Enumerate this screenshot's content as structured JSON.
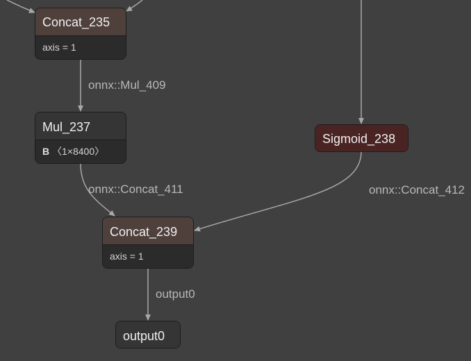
{
  "colors": {
    "background": "#404040",
    "edge": "#a8a8a8",
    "concat_header": "#4f403c",
    "mul_header": "#353535",
    "sigmoid": "#4a2422",
    "attr_bg": "#2b2b2b"
  },
  "nodes": {
    "concat_235": {
      "title": "Concat_235",
      "attr": "axis = 1"
    },
    "mul_237": {
      "title": "Mul_237",
      "attr_name": "B",
      "attr_value": "〈1×8400〉"
    },
    "sigmoid_238": {
      "title": "Sigmoid_238"
    },
    "concat_239": {
      "title": "Concat_239",
      "attr": "axis = 1"
    },
    "output0": {
      "title": "output0"
    }
  },
  "edges": {
    "mul_409": "onnx::Mul_409",
    "concat_411": "onnx::Concat_411",
    "concat_412": "onnx::Concat_412",
    "output0": "output0"
  }
}
